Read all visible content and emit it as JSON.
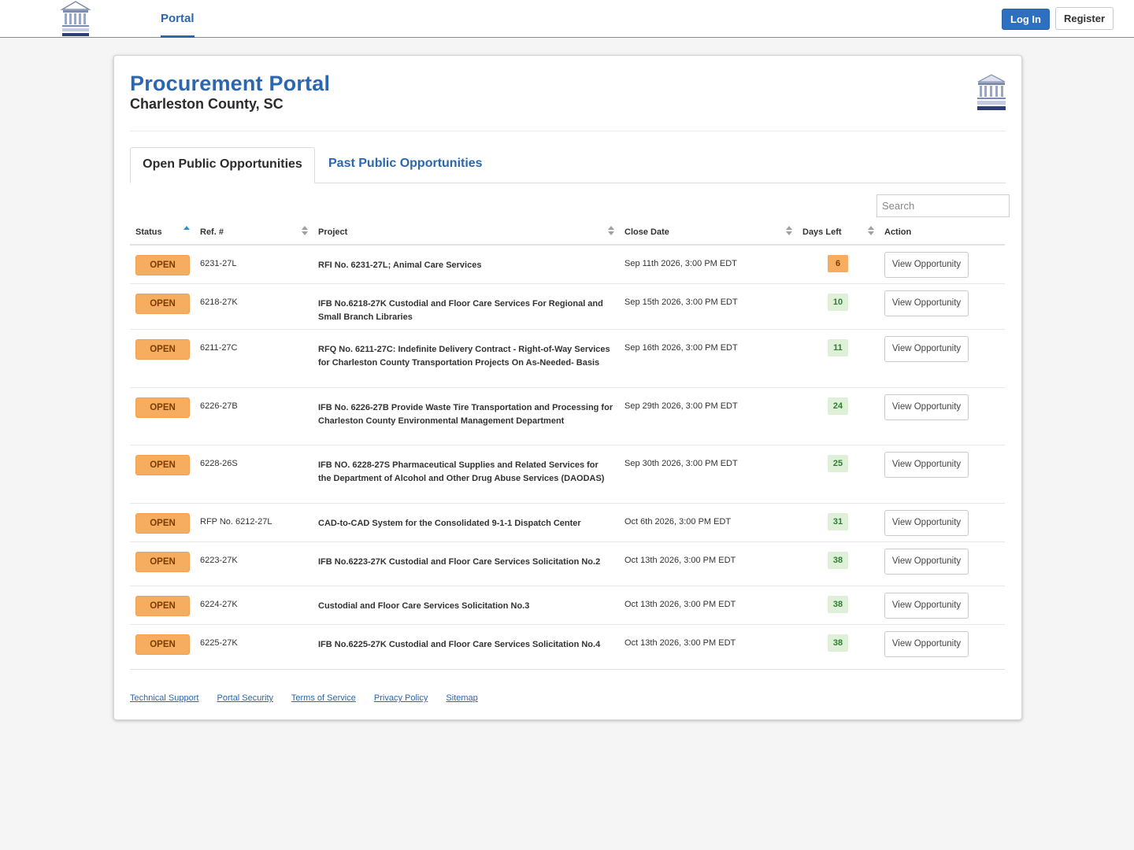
{
  "nav": {
    "portal_tab": "Portal",
    "login_label": "Log In",
    "register_label": "Register"
  },
  "header": {
    "title": "Procurement Portal",
    "subtitle": "Charleston County, SC"
  },
  "tabs": [
    {
      "label": "Open Public Opportunities",
      "active": true
    },
    {
      "label": "Past Public Opportunities",
      "active": false
    }
  ],
  "search": {
    "placeholder": "Search",
    "value": ""
  },
  "table": {
    "columns": [
      "Status",
      "Ref. #",
      "Project",
      "Close Date",
      "Days Left",
      "Action"
    ],
    "sorted_column": "Status",
    "rows": [
      {
        "status": "OPEN",
        "ref": "6231-27L",
        "project": "RFI No. 6231-27L; Animal Care Services",
        "close_date": "Sep 11th 2026, 3:00 PM EDT",
        "days_left": "6",
        "days_level": "warn",
        "action": "View Opportunity"
      },
      {
        "status": "OPEN",
        "ref": "6218-27K",
        "project": "IFB No.6218-27K Custodial and Floor Care Services For Regional and Small Branch Libraries",
        "close_date": "Sep 15th 2026, 3:00 PM EDT",
        "days_left": "10",
        "days_level": "ok",
        "action": "View Opportunity"
      },
      {
        "status": "OPEN",
        "ref": "6211-27C",
        "project": "RFQ No. 6211-27C: Indefinite Delivery Contract - Right-of-Way Services for Charleston County Transportation Projects On As-Needed- Basis",
        "close_date": "Sep 16th 2026, 3:00 PM EDT",
        "days_left": "11",
        "days_level": "ok",
        "action": "View Opportunity"
      },
      {
        "status": "OPEN",
        "ref": "6226-27B",
        "project": "IFB No. 6226-27B Provide Waste Tire Transportation and Processing for Charleston County Environmental Management Department",
        "close_date": "Sep 29th 2026, 3:00 PM EDT",
        "days_left": "24",
        "days_level": "ok",
        "action": "View Opportunity"
      },
      {
        "status": "OPEN",
        "ref": "6228-26S",
        "project": "IFB NO. 6228-27S Pharmaceutical Supplies and Related Services for the Department of Alcohol and Other Drug Abuse Services (DAODAS)",
        "close_date": "Sep 30th 2026, 3:00 PM EDT",
        "days_left": "25",
        "days_level": "ok",
        "action": "View Opportunity"
      },
      {
        "status": "OPEN",
        "ref": "RFP No. 6212-27L",
        "project": "CAD-to-CAD System for the Consolidated 9-1-1 Dispatch Center",
        "close_date": "Oct 6th 2026, 3:00 PM EDT",
        "days_left": "31",
        "days_level": "ok",
        "action": "View Opportunity"
      },
      {
        "status": "OPEN",
        "ref": "6223-27K",
        "project": "IFB No.6223-27K Custodial and Floor Care Services Solicitation No.2",
        "close_date": "Oct 13th 2026, 3:00 PM EDT",
        "days_left": "38",
        "days_level": "ok",
        "action": "View Opportunity"
      },
      {
        "status": "OPEN",
        "ref": "6224-27K",
        "project": "Custodial and Floor Care Services Solicitation No.3",
        "close_date": "Oct 13th 2026, 3:00 PM EDT",
        "days_left": "38",
        "days_level": "ok",
        "action": "View Opportunity"
      },
      {
        "status": "OPEN",
        "ref": "6225-27K",
        "project": "IFB No.6225-27K Custodial and Floor Care Services Solicitation No.4",
        "close_date": "Oct 13th 2026, 3:00 PM EDT",
        "days_left": "38",
        "days_level": "ok",
        "action": "View Opportunity"
      }
    ]
  },
  "footer": {
    "links": [
      "Technical Support",
      "Portal Security",
      "Terms of Service",
      "Privacy Policy",
      "Sitemap"
    ]
  },
  "colors": {
    "brand_blue": "#2a67b0",
    "open_badge": "#f7ad5f",
    "days_ok_bg": "#dff0d8",
    "days_ok_text": "#2e7d32"
  },
  "icons": {
    "logo": "charleston-county-courthouse-logo"
  }
}
